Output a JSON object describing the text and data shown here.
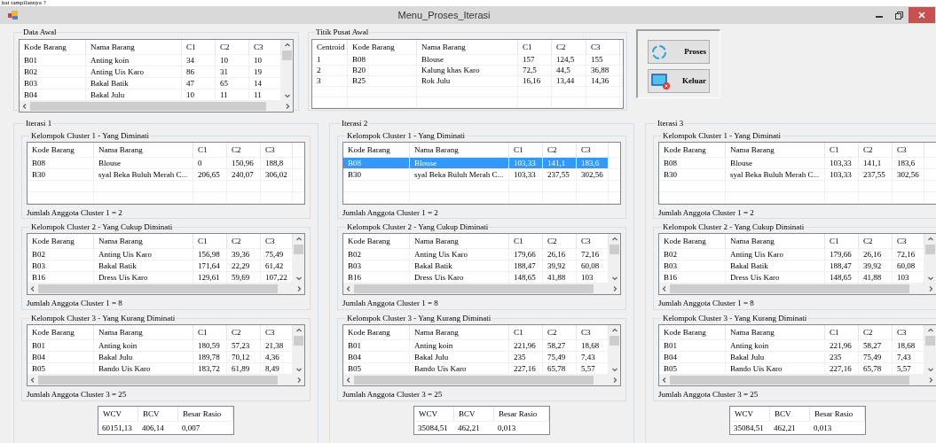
{
  "document_text": "hat tampilannya ?",
  "window": {
    "title": "Menu_Proses_Iterasi"
  },
  "data_awal": {
    "title": "Data Awal",
    "scrollable": true,
    "columns": [
      "Kode Barang",
      "Nama Barang",
      "C1",
      "C2",
      "C3"
    ],
    "rows": [
      {
        "cells": [
          "B01",
          "Anting koin",
          "34",
          "10",
          "10"
        ],
        "selected": false
      },
      {
        "cells": [
          "B02",
          "Anting Uis Karo",
          "86",
          "31",
          "19"
        ],
        "selected": false
      },
      {
        "cells": [
          "B03",
          "Bakal Batik",
          "47",
          "65",
          "14"
        ],
        "selected": false
      },
      {
        "cells": [
          "B04",
          "Bakal Julu",
          "10",
          "11",
          "11"
        ],
        "selected": false
      }
    ]
  },
  "titik_pusat_awal": {
    "title": "Titik Pusat Awal",
    "scrollable": false,
    "columns": [
      "Centroid",
      "Kode Barang",
      "Nama Barang",
      "C1",
      "C2",
      "C3"
    ],
    "rows": [
      {
        "cells": [
          "1",
          "B08",
          "Blouse",
          "157",
          "124,5",
          "155"
        ],
        "selected": false
      },
      {
        "cells": [
          "2",
          "B20",
          "Kalung khas Karo",
          "72,5",
          "44,5",
          "36,88"
        ],
        "selected": false
      },
      {
        "cells": [
          "3",
          "B25",
          "Rok Julu",
          "16,16",
          "13,44",
          "14,36"
        ],
        "selected": false
      }
    ]
  },
  "buttons": [
    {
      "label": "Proses",
      "kind": "process"
    },
    {
      "label": "Keluar",
      "kind": "exit"
    }
  ],
  "iterations": [
    {
      "title": "Iterasi 1",
      "clusters": [
        {
          "title": "Kelompok Cluster 1 - Yang Diminati",
          "scrollable": false,
          "columns": [
            "Kode Barang",
            "Nama Barang",
            "C1",
            "C2",
            "C3"
          ],
          "rows": [
            {
              "cells": [
                "B08",
                "Blouse",
                "0",
                "150,96",
                "188,8"
              ],
              "selected": false
            },
            {
              "cells": [
                "B30",
                "syal Beka Buluh Merah C...",
                "206,65",
                "240,07",
                "306,02"
              ],
              "selected": false
            }
          ],
          "count_label": "Jumlah Anggota Cluster 1 = 2"
        },
        {
          "title": "Kelompok Cluster 2 - Yang Cukup Diminati",
          "scrollable": true,
          "columns": [
            "Kode Barang",
            "Nama Barang",
            "C1",
            "C2",
            "C3"
          ],
          "rows": [
            {
              "cells": [
                "B02",
                "Anting Uis Karo",
                "156,98",
                "39,36",
                "75,49"
              ],
              "selected": false
            },
            {
              "cells": [
                "B03",
                "Bakal Batik",
                "171,64",
                "22,29",
                "61,42"
              ],
              "selected": false
            },
            {
              "cells": [
                "B16",
                "Dress Uis Karo",
                "129,61",
                "59,69",
                "107,22"
              ],
              "selected": false
            }
          ],
          "count_label": "Jumlah Anggota Cluster 1 = 8"
        },
        {
          "title": "Kelompok Cluster 3 - Yang Kurang Diminati",
          "scrollable": true,
          "columns": [
            "Kode Barang",
            "Nama Barang",
            "C1",
            "C2",
            "C3"
          ],
          "rows": [
            {
              "cells": [
                "B01",
                "Anting koin",
                "180,59",
                "57,23",
                "21,38"
              ],
              "selected": false
            },
            {
              "cells": [
                "B04",
                "Bakal Julu",
                "189,78",
                "70,12",
                "4,36"
              ],
              "selected": false
            },
            {
              "cells": [
                "B05",
                "Bando Uis Karo",
                "183,72",
                "61,89",
                "8,49"
              ],
              "selected": false
            }
          ],
          "count_label": "Jumlah Anggota Cluster 3 = 25"
        }
      ],
      "summary": {
        "columns": [
          "WCV",
          "BCV",
          "Besar Rasio"
        ],
        "values": [
          "60151,13",
          "406,14",
          "0,007"
        ]
      }
    },
    {
      "title": "Iterasi 2",
      "clusters": [
        {
          "title": "Kelompok Cluster 1 - Yang Diminati",
          "scrollable": false,
          "columns": [
            "Kode Barang",
            "Nama Barang",
            "C1",
            "C2",
            "C3"
          ],
          "rows": [
            {
              "cells": [
                "B08",
                "Blouse",
                "103,33",
                "141,1",
                "183,6"
              ],
              "selected": true
            },
            {
              "cells": [
                "B30",
                "syal Beka Buluh Merah C...",
                "103,33",
                "237,55",
                "302,56"
              ],
              "selected": false
            }
          ],
          "count_label": "Jumlah Anggota Cluster 1 = 2"
        },
        {
          "title": "Kelompok Cluster 2 - Yang Cukup Diminati",
          "scrollable": true,
          "columns": [
            "Kode Barang",
            "Nama Barang",
            "C1",
            "C2",
            "C3"
          ],
          "rows": [
            {
              "cells": [
                "B02",
                "Anting Uis Karo",
                "179,66",
                "26,16",
                "72,16"
              ],
              "selected": false
            },
            {
              "cells": [
                "B03",
                "Bakal Batik",
                "188,47",
                "39,92",
                "60,08"
              ],
              "selected": false
            },
            {
              "cells": [
                "B16",
                "Dress Uis Karo",
                "148,65",
                "41,88",
                "103"
              ],
              "selected": false
            }
          ],
          "count_label": "Jumlah Anggota Cluster 1 = 8"
        },
        {
          "title": "Kelompok Cluster 3 - Yang Kurang Diminati",
          "scrollable": true,
          "columns": [
            "Kode Barang",
            "Nama Barang",
            "C1",
            "C2",
            "C3"
          ],
          "rows": [
            {
              "cells": [
                "B01",
                "Anting koin",
                "221,96",
                "58,27",
                "18,68"
              ],
              "selected": false
            },
            {
              "cells": [
                "B04",
                "Bakal Julu",
                "235",
                "75,49",
                "7,43"
              ],
              "selected": false
            },
            {
              "cells": [
                "B05",
                "Bando Uis Karo",
                "227,16",
                "65,78",
                "5,57"
              ],
              "selected": false
            }
          ],
          "count_label": "Jumlah Anggota Cluster 3 = 25"
        }
      ],
      "summary": {
        "columns": [
          "WCV",
          "BCV",
          "Besar Rasio"
        ],
        "values": [
          "35084,51",
          "462,21",
          "0,013"
        ]
      }
    },
    {
      "title": "Iterasi 3",
      "clusters": [
        {
          "title": "Kelompok Cluster 1 - Yang Diminati",
          "scrollable": false,
          "columns": [
            "Kode Barang",
            "Nama Barang",
            "C1",
            "C2",
            "C3"
          ],
          "rows": [
            {
              "cells": [
                "B08",
                "Blouse",
                "103,33",
                "141,1",
                "183,6"
              ],
              "selected": false
            },
            {
              "cells": [
                "B30",
                "syal Beka Buluh Merah C...",
                "103,33",
                "237,55",
                "302,56"
              ],
              "selected": false
            }
          ],
          "count_label": "Jumlah Anggota Cluster 1 = 2"
        },
        {
          "title": "Kelompok Cluster 2 - Yang Cukup Diminati",
          "scrollable": true,
          "columns": [
            "Kode Barang",
            "Nama Barang",
            "C1",
            "C2",
            "C3"
          ],
          "rows": [
            {
              "cells": [
                "B02",
                "Anting Uis Karo",
                "179,66",
                "26,16",
                "72,16"
              ],
              "selected": false
            },
            {
              "cells": [
                "B03",
                "Bakal Batik",
                "188,47",
                "39,92",
                "60,08"
              ],
              "selected": false
            },
            {
              "cells": [
                "B16",
                "Dress Uis Karo",
                "148,65",
                "41,88",
                "103"
              ],
              "selected": false
            }
          ],
          "count_label": "Jumlah Anggota Cluster 1 = 8"
        },
        {
          "title": "Kelompok Cluster 3 - Yang Kurang Diminati",
          "scrollable": true,
          "columns": [
            "Kode Barang",
            "Nama Barang",
            "C1",
            "C2",
            "C3"
          ],
          "rows": [
            {
              "cells": [
                "B01",
                "Anting koin",
                "221,96",
                "58,27",
                "18,68"
              ],
              "selected": false
            },
            {
              "cells": [
                "B04",
                "Bakal Julu",
                "235",
                "75,49",
                "7,43"
              ],
              "selected": false
            },
            {
              "cells": [
                "B05",
                "Bando Uis Karo",
                "227,16",
                "65,78",
                "5,57"
              ],
              "selected": false
            }
          ],
          "count_label": "Jumlah Anggota Cluster 3 = 25"
        }
      ],
      "summary": {
        "columns": [
          "WCV",
          "BCV",
          "Besar Rasio"
        ],
        "values": [
          "35084,51",
          "462,21",
          "0,013"
        ]
      }
    }
  ]
}
